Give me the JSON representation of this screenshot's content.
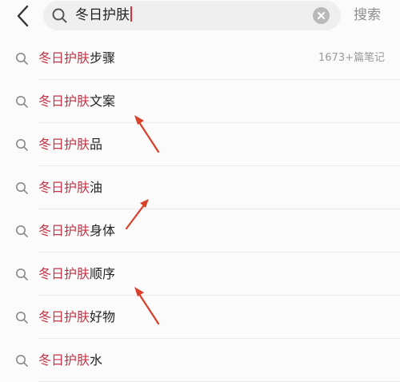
{
  "search": {
    "query": "冬日护肤",
    "button_label": "搜索"
  },
  "suggestions": [
    {
      "highlight": "冬日护肤",
      "rest": "步骤",
      "count": "1673+篇笔记"
    },
    {
      "highlight": "冬日护肤",
      "rest": "文案"
    },
    {
      "highlight": "冬日护肤",
      "rest": "品"
    },
    {
      "highlight": "冬日护肤",
      "rest": "油"
    },
    {
      "highlight": "冬日护肤",
      "rest": "身体"
    },
    {
      "highlight": "冬日护肤",
      "rest": "顺序"
    },
    {
      "highlight": "冬日护肤",
      "rest": "好物"
    },
    {
      "highlight": "冬日护肤",
      "rest": "水"
    }
  ],
  "colors": {
    "highlight": "#c53345",
    "annotation_arrow": "#d9402a"
  },
  "icons": [
    "back-arrow-icon",
    "search-icon",
    "clear-icon"
  ]
}
